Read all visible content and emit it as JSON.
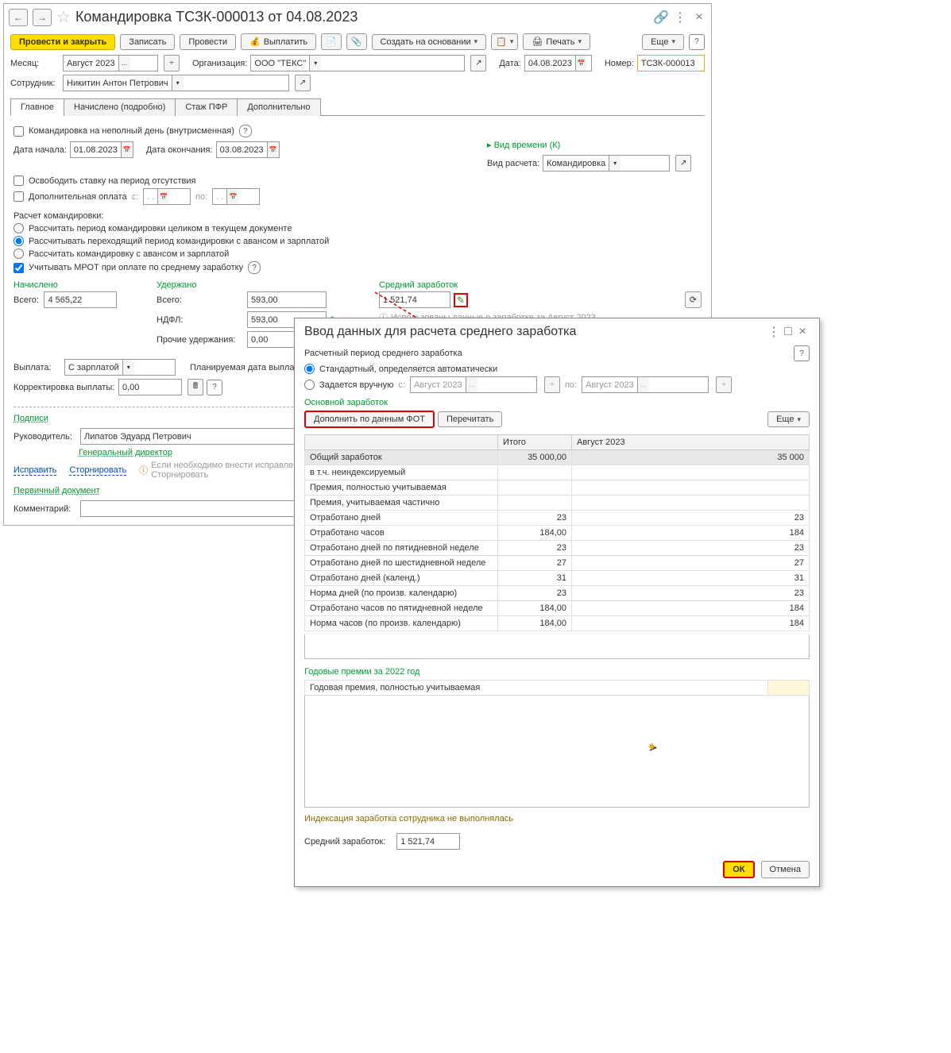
{
  "main": {
    "title": "Командировка ТСЗК-000013 от 04.08.2023",
    "toolbar": {
      "post_close": "Провести и закрыть",
      "write": "Записать",
      "post": "Провести",
      "pay": "Выплатить",
      "create": "Создать на основании",
      "print": "Печать",
      "more": "Еще"
    },
    "header": {
      "month_lbl": "Месяц:",
      "month": "Август 2023",
      "org_lbl": "Организация:",
      "org": "ООО \"ТЕКС\"",
      "date_lbl": "Дата:",
      "date": "04.08.2023",
      "num_lbl": "Номер:",
      "num": "ТСЗК-000013",
      "emp_lbl": "Сотрудник:",
      "emp": "Никитин Антон Петрович"
    },
    "tabs": [
      "Главное",
      "Начислено (подробно)",
      "Стаж ПФР",
      "Дополнительно"
    ],
    "body": {
      "partial": "Командировка на неполный день (внутрисменная)",
      "start_lbl": "Дата начала:",
      "start": "01.08.2023",
      "end_lbl": "Дата окончания:",
      "end": "03.08.2023",
      "timekind_hdr": "Вид времени (К)",
      "calctype_lbl": "Вид расчета:",
      "calctype": "Командировка",
      "free_rate": "Освободить ставку на период отсутствия",
      "extra_pay": "Дополнительная оплата",
      "from": "с:",
      "to": "по:",
      "calc_hdr": "Расчет командировки:",
      "r1": "Рассчитать период командировки целиком в текущем документе",
      "r2": "Рассчитывать переходящий период командировки с авансом и зарплатой",
      "r3": "Рассчитать командировку с авансом и зарплатой",
      "mrot": "Учитывать МРОТ при оплате по среднему заработку",
      "accrued": "Начислено",
      "withheld": "Удержано",
      "avgearn": "Средний заработок",
      "total_lbl": "Всего:",
      "total_acc": "4 565,22",
      "total_wh": "593,00",
      "avg": "1 521,74",
      "ndfl_lbl": "НДФЛ:",
      "ndfl": "593,00",
      "other_lbl": "Прочие удержания:",
      "other": "0,00",
      "info": "Использованы данные о заработке за Август 2023",
      "payout_lbl": "Выплата:",
      "payout": "С зарплатой",
      "planned_lbl": "Планируемая дата выпла",
      "corr_lbl": "Корректировка выплаты:",
      "corr": "0,00",
      "sign": "Подписи",
      "mgr_lbl": "Руководитель:",
      "mgr": "Липатов Эдуард Петрович",
      "mgr_pos": "Генеральный директор",
      "fix": "Исправить",
      "storno": "Сторнировать",
      "fix_hint": "Если необходимо внести исправление\nСторнировать",
      "primary": "Первичный документ",
      "comment_lbl": "Комментарий:"
    }
  },
  "popup": {
    "title": "Ввод данных для расчета среднего заработка",
    "period_lbl": "Расчетный период среднего заработка",
    "std": "Стандартный, определяется автоматически",
    "manual": "Задается вручную",
    "from": "с:",
    "to": "по:",
    "from_v": "Август 2023",
    "to_v": "Август 2023",
    "main_earn": "Основной заработок",
    "fill": "Дополнить по данным ФОТ",
    "reread": "Перечитать",
    "more": "Еще",
    "th_total": "Итого",
    "th_month": "Август 2023",
    "rows": [
      {
        "n": "Общий заработок",
        "t": "35 000,00",
        "m": "35 000"
      },
      {
        "n": "   в т.ч. неиндексируемый",
        "t": "",
        "m": ""
      },
      {
        "n": "Премия, полностью учитываемая",
        "t": "",
        "m": ""
      },
      {
        "n": "Премия, учитываемая частично",
        "t": "",
        "m": ""
      },
      {
        "n": "Отработано дней",
        "t": "23",
        "m": "23"
      },
      {
        "n": "Отработано часов",
        "t": "184,00",
        "m": "184"
      },
      {
        "n": "Отработано дней по пятидневной неделе",
        "t": "23",
        "m": "23"
      },
      {
        "n": "Отработано дней по шестидневной неделе",
        "t": "27",
        "m": "27"
      },
      {
        "n": "Отработано дней (календ.)",
        "t": "31",
        "m": "31"
      },
      {
        "n": "Норма дней (по произв. календарю)",
        "t": "23",
        "m": "23"
      },
      {
        "n": "Отработано часов по пятидневной неделе",
        "t": "184,00",
        "m": "184"
      },
      {
        "n": "Норма часов (по произв. календарю)",
        "t": "184,00",
        "m": "184"
      }
    ],
    "year_hdr": "Годовые премии за 2022 год",
    "year_row": "Годовая премия, полностью учитываемая",
    "index_note": "Индексация заработка сотрудника не выполнялась",
    "avg_lbl": "Средний заработок:",
    "avg": "1 521,74",
    "ok": "ОК",
    "cancel": "Отмена"
  }
}
